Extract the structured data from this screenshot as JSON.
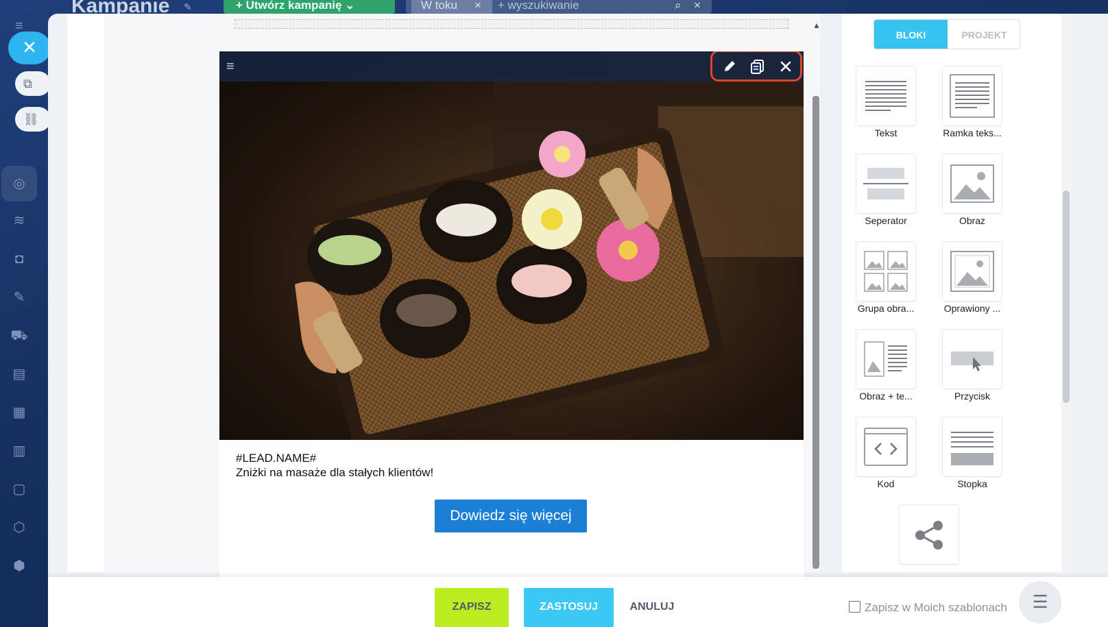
{
  "background": {
    "title": "Kampanie",
    "create_button": "Utwórz kampanię",
    "filter_chip": "W toku",
    "filter_placeholder": "+ wyszukiwanie"
  },
  "editor": {
    "email": {
      "line1": "#LEAD.NAME#",
      "line2": "Zniżki na masaże dla stałych klientów!",
      "button": "Dowiedz się więcej"
    }
  },
  "sidebar": {
    "tabs": [
      "BLOKI",
      "PROJEKT"
    ],
    "blocks": [
      {
        "label": "Tekst",
        "icon": "text-block-icon"
      },
      {
        "label": "Ramka teks...",
        "icon": "text-frame-block-icon"
      },
      {
        "label": "Seperator",
        "icon": "separator-block-icon"
      },
      {
        "label": "Obraz",
        "icon": "image-block-icon"
      },
      {
        "label": "Grupa obra...",
        "icon": "image-group-block-icon"
      },
      {
        "label": "Oprawiony ...",
        "icon": "framed-image-block-icon"
      },
      {
        "label": "Obraz + te...",
        "icon": "image-text-block-icon"
      },
      {
        "label": "Przycisk",
        "icon": "button-block-icon"
      },
      {
        "label": "Kod",
        "icon": "code-block-icon"
      },
      {
        "label": "Stopka",
        "icon": "footer-block-icon"
      },
      {
        "label": "",
        "icon": "share-block-icon"
      }
    ]
  },
  "footer": {
    "save": "ZAPISZ",
    "apply": "ZASTOSUJ",
    "cancel": "ANULUJ",
    "save_template": "Zapisz w Moich szablonach"
  },
  "colors": {
    "accent": "#3bc8f5",
    "save_green": "#bbed21",
    "cta_blue": "#1b7fd6",
    "highlight_red": "#e2452b"
  }
}
